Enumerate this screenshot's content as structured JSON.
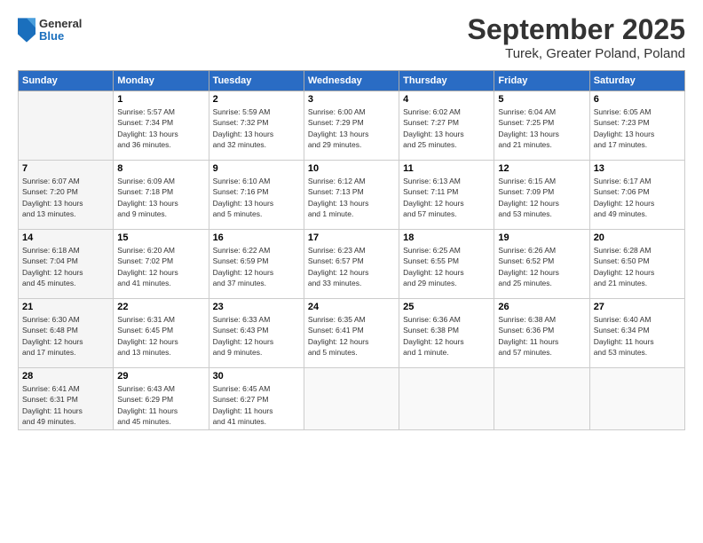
{
  "header": {
    "logo_general": "General",
    "logo_blue": "Blue",
    "title": "September 2025",
    "subtitle": "Turek, Greater Poland, Poland"
  },
  "calendar": {
    "days_of_week": [
      "Sunday",
      "Monday",
      "Tuesday",
      "Wednesday",
      "Thursday",
      "Friday",
      "Saturday"
    ],
    "weeks": [
      [
        {
          "day": "",
          "info": ""
        },
        {
          "day": "1",
          "info": "Sunrise: 5:57 AM\nSunset: 7:34 PM\nDaylight: 13 hours\nand 36 minutes."
        },
        {
          "day": "2",
          "info": "Sunrise: 5:59 AM\nSunset: 7:32 PM\nDaylight: 13 hours\nand 32 minutes."
        },
        {
          "day": "3",
          "info": "Sunrise: 6:00 AM\nSunset: 7:29 PM\nDaylight: 13 hours\nand 29 minutes."
        },
        {
          "day": "4",
          "info": "Sunrise: 6:02 AM\nSunset: 7:27 PM\nDaylight: 13 hours\nand 25 minutes."
        },
        {
          "day": "5",
          "info": "Sunrise: 6:04 AM\nSunset: 7:25 PM\nDaylight: 13 hours\nand 21 minutes."
        },
        {
          "day": "6",
          "info": "Sunrise: 6:05 AM\nSunset: 7:23 PM\nDaylight: 13 hours\nand 17 minutes."
        }
      ],
      [
        {
          "day": "7",
          "info": "Sunrise: 6:07 AM\nSunset: 7:20 PM\nDaylight: 13 hours\nand 13 minutes."
        },
        {
          "day": "8",
          "info": "Sunrise: 6:09 AM\nSunset: 7:18 PM\nDaylight: 13 hours\nand 9 minutes."
        },
        {
          "day": "9",
          "info": "Sunrise: 6:10 AM\nSunset: 7:16 PM\nDaylight: 13 hours\nand 5 minutes."
        },
        {
          "day": "10",
          "info": "Sunrise: 6:12 AM\nSunset: 7:13 PM\nDaylight: 13 hours\nand 1 minute."
        },
        {
          "day": "11",
          "info": "Sunrise: 6:13 AM\nSunset: 7:11 PM\nDaylight: 12 hours\nand 57 minutes."
        },
        {
          "day": "12",
          "info": "Sunrise: 6:15 AM\nSunset: 7:09 PM\nDaylight: 12 hours\nand 53 minutes."
        },
        {
          "day": "13",
          "info": "Sunrise: 6:17 AM\nSunset: 7:06 PM\nDaylight: 12 hours\nand 49 minutes."
        }
      ],
      [
        {
          "day": "14",
          "info": "Sunrise: 6:18 AM\nSunset: 7:04 PM\nDaylight: 12 hours\nand 45 minutes."
        },
        {
          "day": "15",
          "info": "Sunrise: 6:20 AM\nSunset: 7:02 PM\nDaylight: 12 hours\nand 41 minutes."
        },
        {
          "day": "16",
          "info": "Sunrise: 6:22 AM\nSunset: 6:59 PM\nDaylight: 12 hours\nand 37 minutes."
        },
        {
          "day": "17",
          "info": "Sunrise: 6:23 AM\nSunset: 6:57 PM\nDaylight: 12 hours\nand 33 minutes."
        },
        {
          "day": "18",
          "info": "Sunrise: 6:25 AM\nSunset: 6:55 PM\nDaylight: 12 hours\nand 29 minutes."
        },
        {
          "day": "19",
          "info": "Sunrise: 6:26 AM\nSunset: 6:52 PM\nDaylight: 12 hours\nand 25 minutes."
        },
        {
          "day": "20",
          "info": "Sunrise: 6:28 AM\nSunset: 6:50 PM\nDaylight: 12 hours\nand 21 minutes."
        }
      ],
      [
        {
          "day": "21",
          "info": "Sunrise: 6:30 AM\nSunset: 6:48 PM\nDaylight: 12 hours\nand 17 minutes."
        },
        {
          "day": "22",
          "info": "Sunrise: 6:31 AM\nSunset: 6:45 PM\nDaylight: 12 hours\nand 13 minutes."
        },
        {
          "day": "23",
          "info": "Sunrise: 6:33 AM\nSunset: 6:43 PM\nDaylight: 12 hours\nand 9 minutes."
        },
        {
          "day": "24",
          "info": "Sunrise: 6:35 AM\nSunset: 6:41 PM\nDaylight: 12 hours\nand 5 minutes."
        },
        {
          "day": "25",
          "info": "Sunrise: 6:36 AM\nSunset: 6:38 PM\nDaylight: 12 hours\nand 1 minute."
        },
        {
          "day": "26",
          "info": "Sunrise: 6:38 AM\nSunset: 6:36 PM\nDaylight: 11 hours\nand 57 minutes."
        },
        {
          "day": "27",
          "info": "Sunrise: 6:40 AM\nSunset: 6:34 PM\nDaylight: 11 hours\nand 53 minutes."
        }
      ],
      [
        {
          "day": "28",
          "info": "Sunrise: 6:41 AM\nSunset: 6:31 PM\nDaylight: 11 hours\nand 49 minutes."
        },
        {
          "day": "29",
          "info": "Sunrise: 6:43 AM\nSunset: 6:29 PM\nDaylight: 11 hours\nand 45 minutes."
        },
        {
          "day": "30",
          "info": "Sunrise: 6:45 AM\nSunset: 6:27 PM\nDaylight: 11 hours\nand 41 minutes."
        },
        {
          "day": "",
          "info": ""
        },
        {
          "day": "",
          "info": ""
        },
        {
          "day": "",
          "info": ""
        },
        {
          "day": "",
          "info": ""
        }
      ]
    ]
  }
}
